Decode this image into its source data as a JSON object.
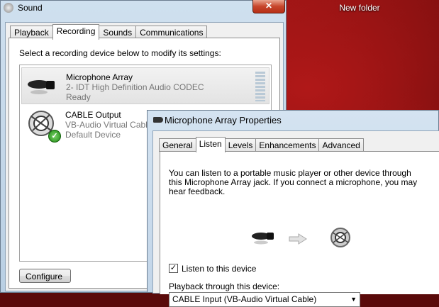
{
  "desktop": {
    "folder_label": "New folder"
  },
  "sound_window": {
    "title": "Sound",
    "close_label": "✕",
    "tabs": [
      "Playback",
      "Recording",
      "Sounds",
      "Communications"
    ],
    "active_tab": "Recording",
    "instruction": "Select a recording device below to modify its settings:",
    "devices": [
      {
        "name": "Microphone Array",
        "driver": "2- IDT High Definition Audio CODEC",
        "status": "Ready",
        "icon": "microphone-icon"
      },
      {
        "name": "CABLE Output",
        "driver": "VB-Audio Virtual Cable",
        "status": "Default Device",
        "icon": "cable-device-icon"
      }
    ],
    "configure_label": "Configure"
  },
  "properties_dialog": {
    "title": "Microphone Array Properties",
    "tabs": [
      "General",
      "Listen",
      "Levels",
      "Enhancements",
      "Advanced"
    ],
    "active_tab": "Listen",
    "description": "You can listen to a portable music player or other device through this Microphone Array jack.  If you connect a microphone, you may hear feedback.",
    "listen_checkbox_label": "Listen to this device",
    "listen_checked": true,
    "playback_label": "Playback through this device:",
    "playback_selected": "CABLE Input (VB-Audio Virtual Cable)"
  }
}
